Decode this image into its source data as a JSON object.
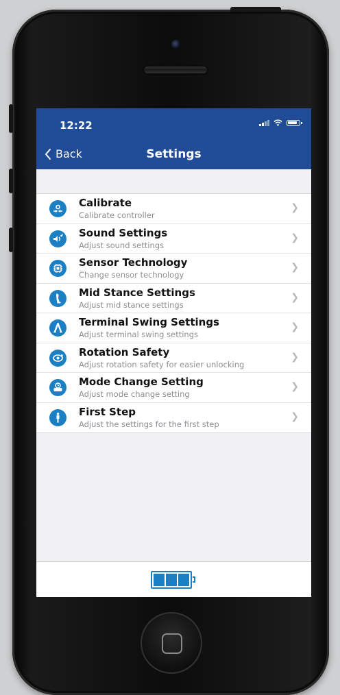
{
  "status_bar": {
    "time": "12:22"
  },
  "nav": {
    "back_label": "Back",
    "title": "Settings"
  },
  "settings": [
    {
      "title": "Calibrate",
      "subtitle": "Calibrate controller",
      "icon": "calibrate-icon"
    },
    {
      "title": "Sound Settings",
      "subtitle": "Adjust sound settings",
      "icon": "sound-icon"
    },
    {
      "title": "Sensor Technology",
      "subtitle": "Change sensor technology",
      "icon": "sensor-chip-icon"
    },
    {
      "title": "Mid Stance Settings",
      "subtitle": "Adjust mid stance settings",
      "icon": "leg-icon"
    },
    {
      "title": "Terminal Swing Settings",
      "subtitle": "Adjust terminal swing settings",
      "icon": "stride-icon"
    },
    {
      "title": "Rotation Safety",
      "subtitle": "Adjust rotation safety for easier unlocking",
      "icon": "rotation-icon"
    },
    {
      "title": "Mode Change Setting",
      "subtitle": "Adjust mode change setting",
      "icon": "mode-change-icon"
    },
    {
      "title": "First Step",
      "subtitle": "Adjust the settings for the first step",
      "icon": "first-step-icon"
    }
  ],
  "battery": {
    "icon": "battery-icon",
    "level": 1.0
  },
  "colors": {
    "header": "#1f4b97",
    "accent": "#1b7fc4",
    "subtitle": "#8e8e93"
  }
}
